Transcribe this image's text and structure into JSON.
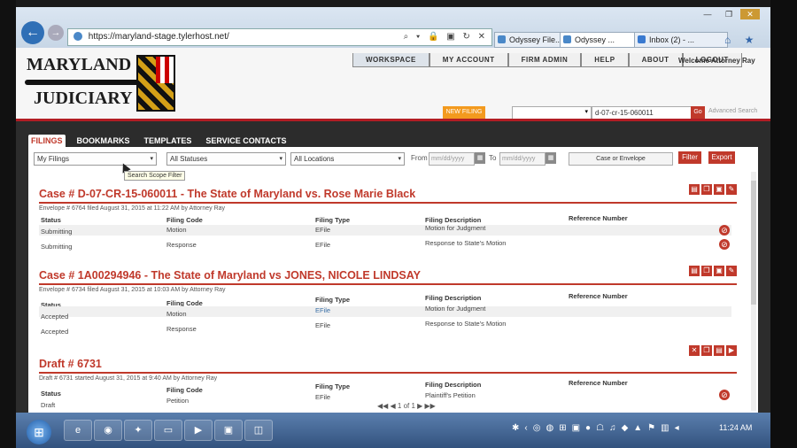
{
  "browser": {
    "url": "https://maryland-stage.tylerhost.net/",
    "tabs": [
      {
        "label": "Odyssey File..."
      },
      {
        "label": "Odyssey ..."
      },
      {
        "label": "Inbox (2) - ..."
      }
    ],
    "window_controls": [
      "—",
      "❐",
      "✕"
    ],
    "address_tools": "⌕ ▾ 🔒 ▣ ↻ ✕",
    "nav_icons": "⌂ ★ ⚙"
  },
  "header": {
    "logo_top": "MARYLAND",
    "logo_bottom": "JUDICIARY",
    "nav": [
      "WORKSPACE",
      "MY ACCOUNT",
      "FIRM ADMIN",
      "HELP",
      "ABOUT",
      "LOGOUT"
    ],
    "welcome": "Welcome Attorney Ray",
    "orange_button": "NEW FILING",
    "case_search_value": "d-07-cr-15-060011",
    "go_label": "Go",
    "advanced_search": "Advanced Search"
  },
  "tabs": [
    "FILINGS",
    "BOOKMARKS",
    "TEMPLATES",
    "SERVICE CONTACTS"
  ],
  "filters": {
    "scope": "My Filings",
    "status": "All Statuses",
    "location": "All Locations",
    "from_label": "From",
    "to_label": "To",
    "from_placeholder": "mm/dd/yyyy",
    "to_placeholder": "mm/dd/yyyy",
    "case_or_envelope": "Case or Envelope",
    "filter_button": "Filter",
    "export_button": "Export",
    "tooltip": "Search Scope Filter"
  },
  "columns": {
    "status": "Status",
    "filing_code": "Filing Code",
    "filing_type": "Filing Type",
    "filing_description": "Filing Description",
    "reference_number": "Reference Number"
  },
  "cases": [
    {
      "title": "Case # D-07-CR-15-060011 - The State of Maryland vs. Rose Marie Black",
      "info": "Envelope # 6764 filed August 31, 2015 at 11:22 AM by Attorney Ray",
      "rows": [
        {
          "status": "Submitting",
          "code": "Motion",
          "type": "EFile",
          "desc": "Motion for Judgment"
        },
        {
          "status": "Submitting",
          "code": "Response",
          "type": "EFile",
          "desc": "Response to State's Motion"
        }
      ]
    },
    {
      "title": "Case # 1A00294946 - The State of Maryland vs JONES, NICOLE LINDSAY",
      "info": "Envelope # 6734 filed August 31, 2015 at 10:03 AM by Attorney Ray",
      "rows": [
        {
          "status": "Accepted",
          "code": "Motion",
          "type": "EFile",
          "desc": "Motion for Judgment"
        },
        {
          "status": "Accepted",
          "code": "Response",
          "type": "EFile",
          "desc": "Response to State's Motion"
        }
      ]
    },
    {
      "title": "Draft # 6731",
      "info": "Draft # 6731 started August 31, 2015 at 9:40 AM by Attorney Ray",
      "rows": [
        {
          "status": "Draft",
          "code": "Petition",
          "type": "EFile",
          "desc": "Plaintiff's Petition"
        }
      ]
    }
  ],
  "pager": "◀◀ ◀ 1 of 1 ▶ ▶▶",
  "taskbar": {
    "clock": "11:24 AM"
  }
}
